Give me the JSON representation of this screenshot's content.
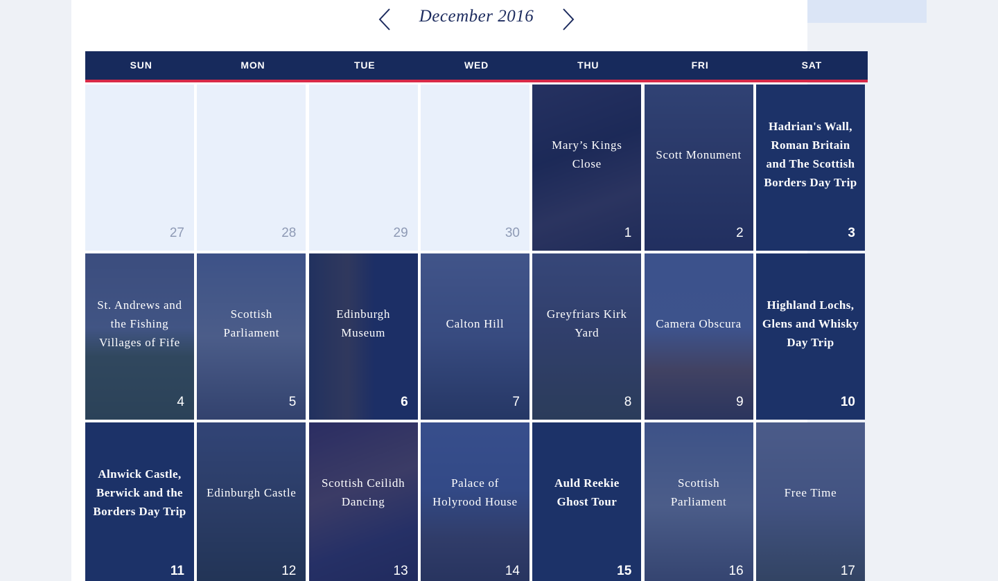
{
  "calendar": {
    "month_label": "December 2016",
    "prev_icon": "chevron-left-icon",
    "next_icon": "chevron-right-icon",
    "weekdays": [
      "SUN",
      "MON",
      "TUE",
      "WED",
      "THU",
      "FRI",
      "SAT"
    ],
    "accent_color": "#d92a48",
    "header_color": "#172a5c",
    "weeks": [
      [
        {
          "day": "27",
          "title": "",
          "style": "empty"
        },
        {
          "day": "28",
          "title": "",
          "style": "empty"
        },
        {
          "day": "29",
          "title": "",
          "style": "empty"
        },
        {
          "day": "30",
          "title": "",
          "style": "empty"
        },
        {
          "day": "1",
          "title": "Mary’s Kings Close",
          "style": "photo",
          "photo": "alley"
        },
        {
          "day": "2",
          "title": "Scott Monument",
          "style": "photo",
          "photo": "monument"
        },
        {
          "day": "3",
          "title": "Hadrian's Wall, Roman Britain and The Scottish Borders Day Trip",
          "style": "plain"
        }
      ],
      [
        {
          "day": "4",
          "title": "St. Andrews and the Fishing Villages of Fife",
          "style": "photo",
          "photo": "golf"
        },
        {
          "day": "5",
          "title": "Scottish Parliament",
          "style": "photo",
          "photo": "parliament"
        },
        {
          "day": "6",
          "title": "Edinburgh Museum",
          "style": "photo",
          "photo": "museum",
          "bold": true
        },
        {
          "day": "7",
          "title": "Calton Hill",
          "style": "photo",
          "photo": "calton"
        },
        {
          "day": "8",
          "title": "Greyfriars Kirk Yard",
          "style": "photo",
          "photo": "greyfriars"
        },
        {
          "day": "9",
          "title": "Camera Obscura",
          "style": "photo",
          "photo": "camera"
        },
        {
          "day": "10",
          "title": "Highland Lochs, Glens and Whisky Day Trip",
          "style": "plain"
        }
      ],
      [
        {
          "day": "11",
          "title": "Alnwick Castle, Berwick and the Borders Day Trip",
          "style": "plain"
        },
        {
          "day": "12",
          "title": "Edinburgh Castle",
          "style": "photo",
          "photo": "castle"
        },
        {
          "day": "13",
          "title": "Scottish Ceilidh Dancing",
          "style": "photo",
          "photo": "ceilidh"
        },
        {
          "day": "14",
          "title": "Palace of Holyrood House",
          "style": "photo",
          "photo": "holyrood"
        },
        {
          "day": "15",
          "title": "Auld Reekie Ghost Tour",
          "style": "plain"
        },
        {
          "day": "16",
          "title": "Scottish Parliament",
          "style": "photo",
          "photo": "parliament"
        },
        {
          "day": "17",
          "title": "Free Time",
          "style": "photo",
          "photo": "free"
        }
      ]
    ]
  }
}
